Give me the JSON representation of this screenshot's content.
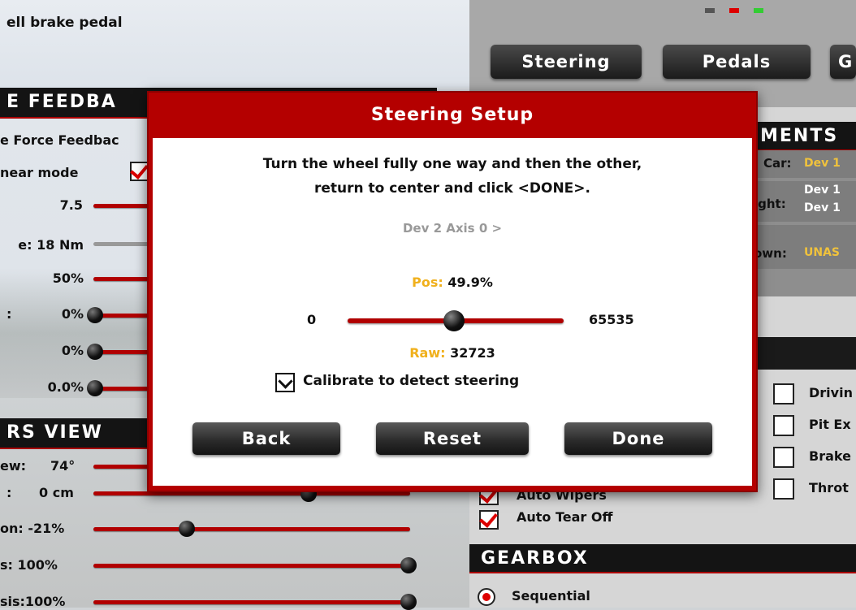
{
  "left": {
    "top_label": "ell brake pedal",
    "ffb_section": "E FEEDBA",
    "ffb_rows": [
      {
        "label": "e Force Feedbac"
      },
      {
        "label": "near mode"
      },
      {
        "label": "7.5"
      },
      {
        "label": "e: 18 Nm"
      },
      {
        "label": "50%"
      },
      {
        "label": ":"
      },
      {
        "label": "0%"
      },
      {
        "label": "0%"
      },
      {
        "label": "0.0%"
      }
    ],
    "view_section": "RS VIEW",
    "view_rows": [
      {
        "label": "ew:",
        "value": "74°"
      },
      {
        "label": ":",
        "value": "0 cm"
      },
      {
        "label": "on: -21%"
      },
      {
        "label": "s: 100%"
      },
      {
        "label": "sis:100%"
      }
    ]
  },
  "right": {
    "tabs": [
      "Steering",
      "Pedals",
      "G"
    ],
    "assign_section": "MENTS",
    "assign": {
      "car_key": "Car:",
      "car_val": "Dev 1",
      "light_key": "ight:",
      "light_val1": "Dev 1",
      "light_val2": "Dev 1",
      "down_key": "own:",
      "down_val": "UNAS"
    },
    "aux_checks": [
      "Drivin",
      "Pit Ex",
      "Brake",
      "Throt"
    ],
    "auto_wipers": "Auto Wipers",
    "auto_tear_off": "Auto Tear Off",
    "gearbox_section": "GEARBOX",
    "gearbox_option": "Sequential"
  },
  "modal": {
    "title": "Steering Setup",
    "instruction_line1": "Turn the wheel fully one way and then the other,",
    "instruction_line2": "return to center and click <DONE>.",
    "axis_label": "Dev 2 Axis 0 >",
    "pos_key": "Pos:",
    "pos_value": "49.9%",
    "range_min": "0",
    "range_max": "65535",
    "raw_key": "Raw:",
    "raw_value": "32723",
    "calibrate_label": "Calibrate to detect steering",
    "buttons": {
      "back": "Back",
      "reset": "Reset",
      "done": "Done"
    }
  },
  "colors": {
    "accent_red": "#b40000",
    "highlight_yellow": "#f0b01c"
  }
}
